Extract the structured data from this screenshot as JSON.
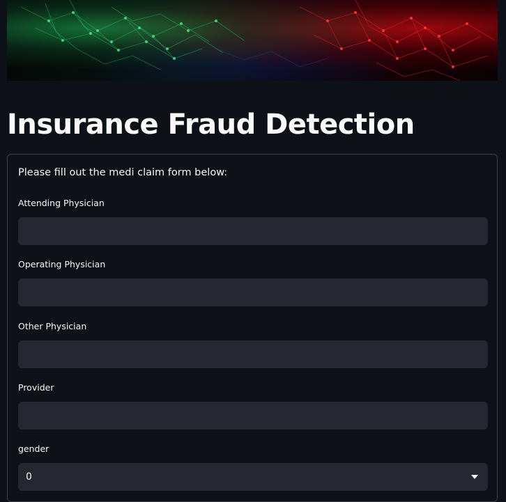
{
  "page": {
    "title": "Insurance Fraud Detection"
  },
  "form": {
    "intro": "Please fill out the medi claim form below:",
    "fields": [
      {
        "label": "Attending Physician",
        "value": ""
      },
      {
        "label": "Operating Physician",
        "value": ""
      },
      {
        "label": "Other Physician",
        "value": ""
      },
      {
        "label": "Provider",
        "value": ""
      }
    ],
    "gender": {
      "label": "gender",
      "selected": "0"
    }
  },
  "colors": {
    "background": "#0e1117",
    "input_background": "#262730",
    "text": "#fafafa"
  },
  "icons": {
    "select_caret": "chevron-down-icon"
  }
}
